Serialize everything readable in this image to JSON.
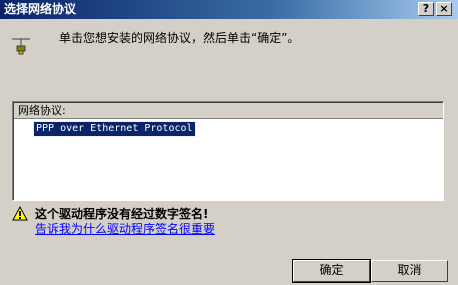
{
  "window": {
    "title": "选择网络协议",
    "help_glyph": "?",
    "close_glyph": "×"
  },
  "instruction": "单击您想安装的网络协议，然后单击“确定”。",
  "protocol_list": {
    "header": "网络协议:",
    "items": [
      "PPP over Ethernet Protocol"
    ],
    "selected_index": 0
  },
  "warning": {
    "text": "这个驱动程序没有经过数字签名!",
    "link": "告诉我为什么驱动程序签名很重要",
    "icon": "warning-icon"
  },
  "buttons": {
    "ok": "确定",
    "cancel": "取消"
  },
  "colors": {
    "face": "#d4d0c8",
    "titlebar": "#0a246a",
    "selection": "#0a246a",
    "link": "#0000ff"
  }
}
